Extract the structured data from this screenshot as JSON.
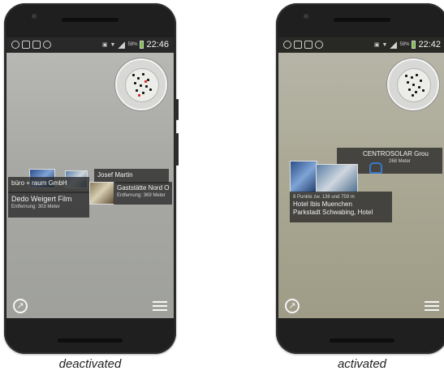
{
  "left_phone": {
    "status_bar": {
      "time": "22:46",
      "battery": "59%"
    },
    "poi_cards": [
      {
        "title": "büro + raum GmbH",
        "subtitle": ""
      },
      {
        "title": "Josef Martin",
        "subtitle": ""
      },
      {
        "title": "Dedo Weigert Film",
        "subtitle": "Entfernung: 303 Meter"
      },
      {
        "title": "Gaststätte Nord O",
        "subtitle": "Entfernung: 369 Meter"
      }
    ],
    "caption": "deactivated"
  },
  "right_phone": {
    "status_bar": {
      "time": "22:42",
      "battery": "59%"
    },
    "poi_cards": [
      {
        "title": "CENTROSOLAR Grou",
        "subtitle": "268 Meter"
      },
      {
        "count_line": "8 Punkte zw. 136 und 759 m",
        "line1": "Hotel Ibis Muenchen",
        "line2": "Parkstadt Schwabing, Hotel"
      }
    ],
    "caption": "activated"
  },
  "icons": {
    "compass": "compass-icon",
    "menu": "hamburger-menu-icon",
    "radar": "radar-icon"
  },
  "colors": {
    "battery": "#7bc043",
    "status_bar_bg": "#1a1a1a",
    "card_bg": "#2a2a2a"
  }
}
